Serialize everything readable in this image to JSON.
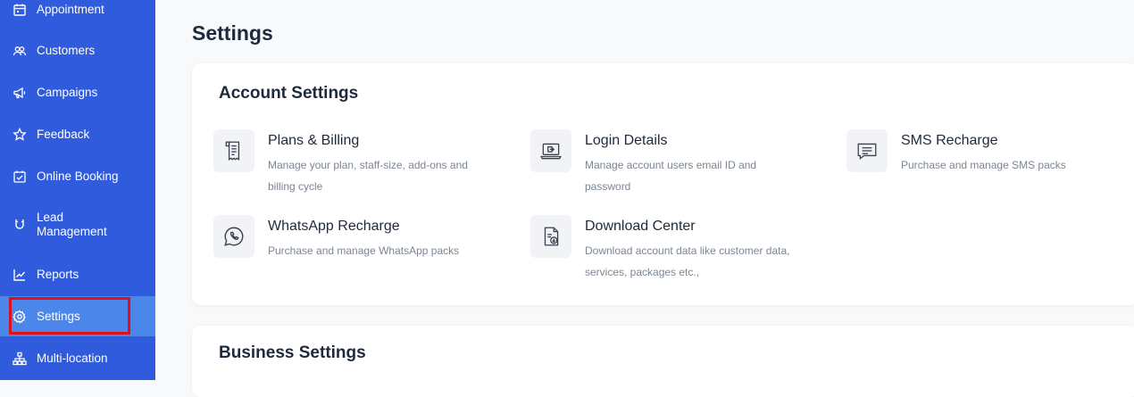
{
  "sidebar": {
    "items": [
      {
        "label": "Appointment",
        "icon": "calendar-icon"
      },
      {
        "label": "Customers",
        "icon": "users-icon"
      },
      {
        "label": "Campaigns",
        "icon": "megaphone-icon"
      },
      {
        "label": "Feedback",
        "icon": "star-icon"
      },
      {
        "label": "Online Booking",
        "icon": "calendar-check-icon"
      },
      {
        "label": "Lead Management",
        "icon": "magnet-icon"
      },
      {
        "label": "Reports",
        "icon": "chart-line-icon"
      },
      {
        "label": "Settings",
        "icon": "gear-icon",
        "active": true
      },
      {
        "label": "Multi-location",
        "icon": "sitemap-icon"
      }
    ],
    "active_color": "#4b86ea",
    "background_color": "#2f5bdc"
  },
  "page": {
    "title": "Settings"
  },
  "account_settings": {
    "title": "Account Settings",
    "tiles": [
      {
        "title": "Plans & Billing",
        "description": "Manage your plan, staff-size, add-ons and billing cycle",
        "icon": "receipt-icon"
      },
      {
        "title": "Login Details",
        "description": "Manage account users email ID and password",
        "icon": "laptop-login-icon"
      },
      {
        "title": "SMS Recharge",
        "description": "Purchase and manage SMS packs",
        "icon": "message-icon"
      },
      {
        "title": "WhatsApp Recharge",
        "description": "Purchase and manage WhatsApp packs",
        "icon": "whatsapp-icon"
      },
      {
        "title": "Download Center",
        "description": "Download account data like customer data, services, packages etc.,",
        "icon": "file-download-icon"
      }
    ]
  },
  "business_settings": {
    "title": "Business Settings"
  }
}
